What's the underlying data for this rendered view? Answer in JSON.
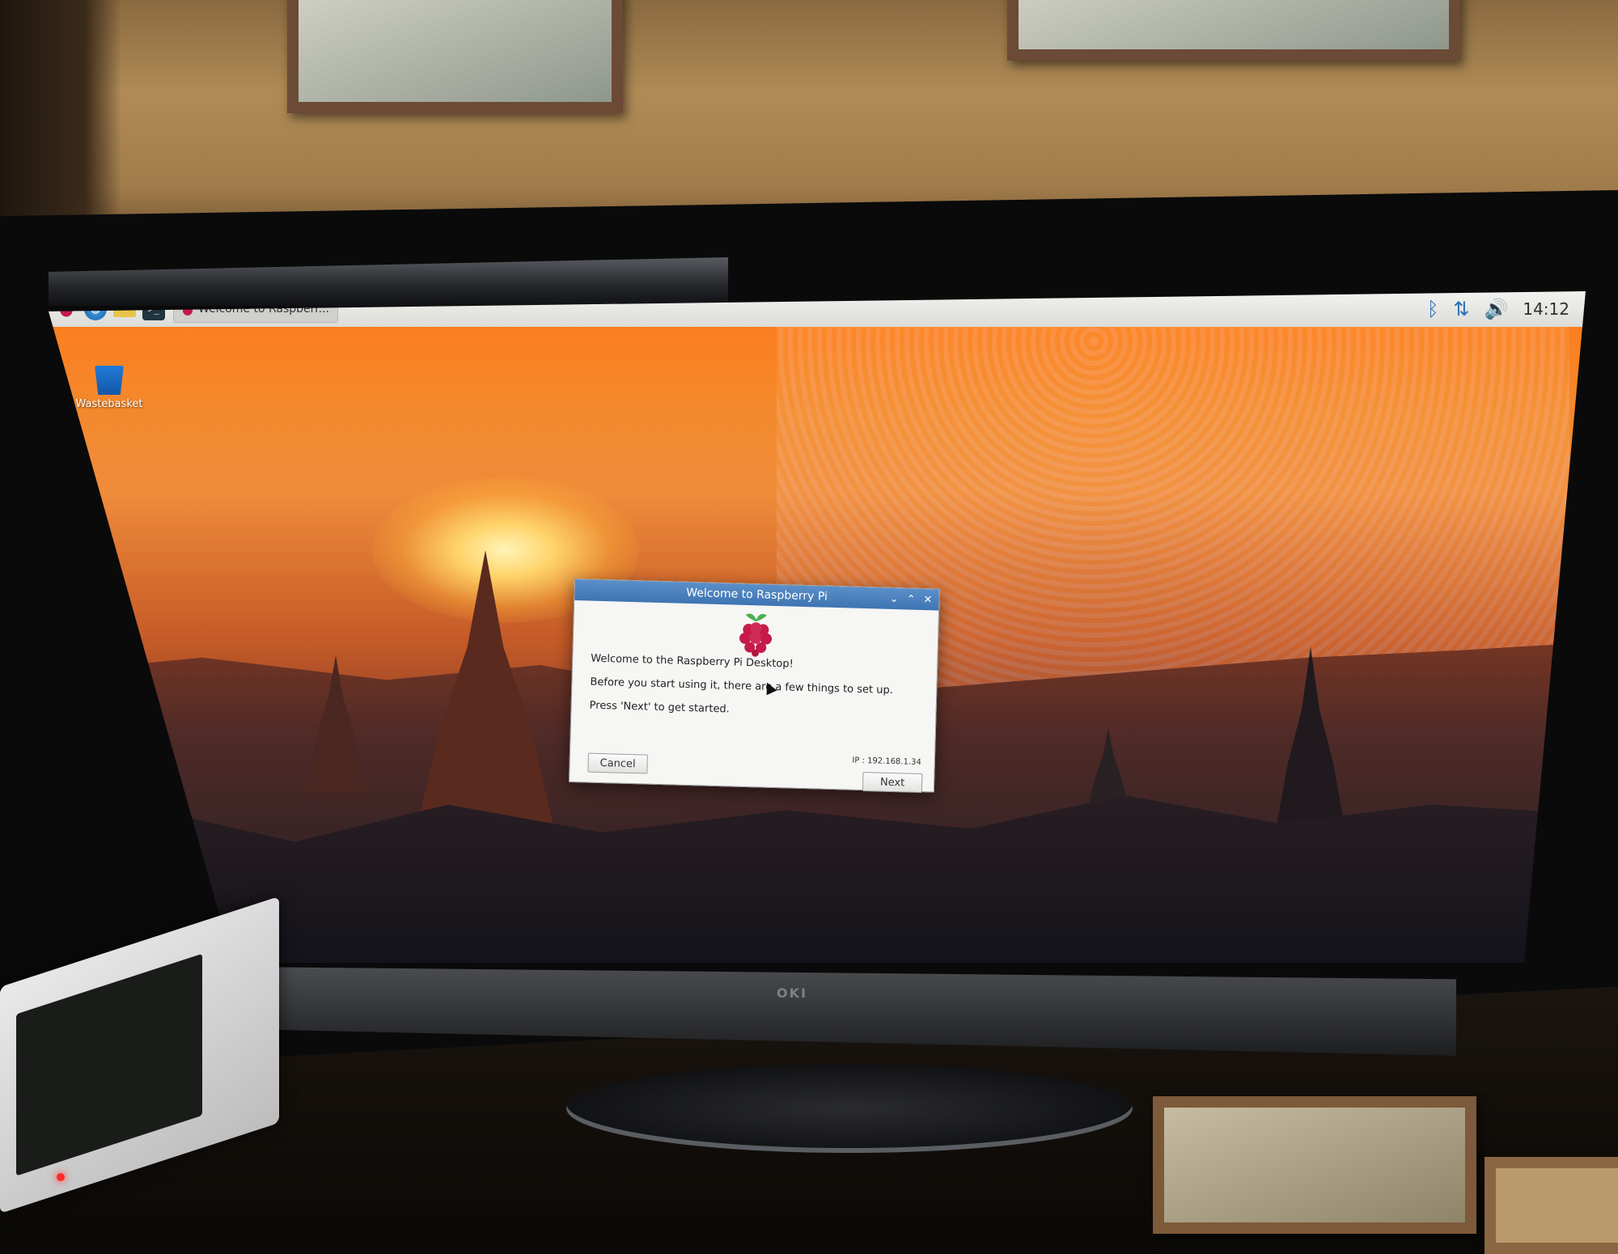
{
  "taskbar": {
    "task_label": "Welcome to Raspberr...",
    "clock": "14:12",
    "icons": [
      "raspberry-menu-icon",
      "web-browser-icon",
      "file-manager-icon",
      "terminal-icon",
      "bluetooth-icon",
      "network-icon",
      "volume-icon"
    ]
  },
  "desktop": {
    "wastebasket_label": "Wastebasket"
  },
  "dialog": {
    "title": "Welcome to Raspberry Pi",
    "welcome_text": "Welcome to the Raspberry Pi Desktop!",
    "setup_text": "Before you start using it, there are a few things to set up.",
    "next_hint": "Press 'Next' to get started.",
    "ip_text": "IP : 192.168.1.34",
    "cancel_label": "Cancel",
    "next_label": "Next"
  },
  "monitor": {
    "brand": "OKI"
  },
  "colors": {
    "dialog_titlebar": "#3e74b3",
    "raspberry": "#c51a4a",
    "tray_icons": "#2a6fb5"
  }
}
